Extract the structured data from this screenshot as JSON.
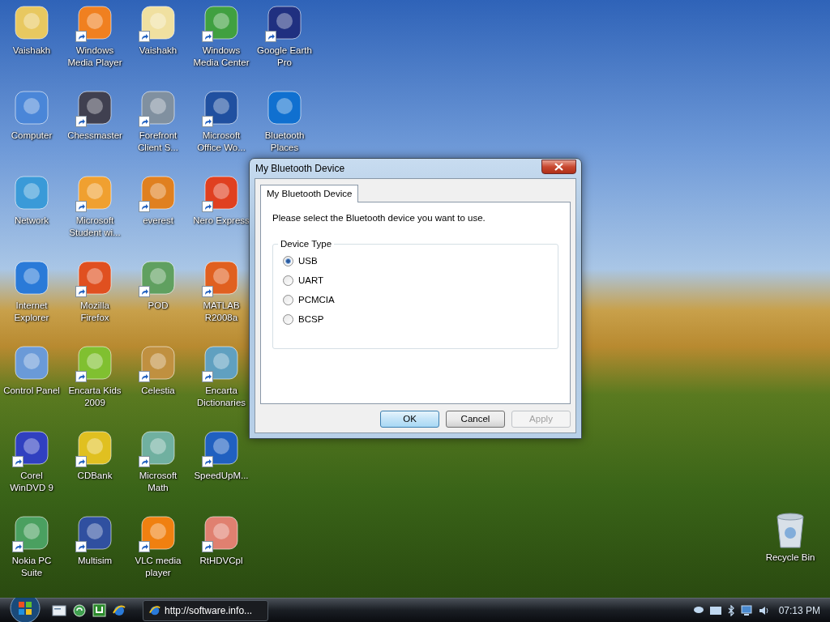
{
  "desktop": {
    "icons": [
      {
        "label": "Vaishakh",
        "shortcut": false
      },
      {
        "label": "Computer",
        "shortcut": false
      },
      {
        "label": "Network",
        "shortcut": false
      },
      {
        "label": "Internet Explorer",
        "shortcut": false
      },
      {
        "label": "Control Panel",
        "shortcut": false
      },
      {
        "label": "Corel WinDVD 9",
        "shortcut": true
      },
      {
        "label": "Nokia PC Suite",
        "shortcut": true
      },
      {
        "label": "Windows Media Player",
        "shortcut": true
      },
      {
        "label": "Chessmaster",
        "shortcut": true
      },
      {
        "label": "Microsoft Student wi...",
        "shortcut": true
      },
      {
        "label": "Mozilla Firefox",
        "shortcut": true
      },
      {
        "label": "Encarta Kids 2009",
        "shortcut": true
      },
      {
        "label": "CDBank",
        "shortcut": true
      },
      {
        "label": "Multisim",
        "shortcut": true
      },
      {
        "label": "Vaishakh",
        "shortcut": true
      },
      {
        "label": "Forefront Client S...",
        "shortcut": true
      },
      {
        "label": "everest",
        "shortcut": true
      },
      {
        "label": "POD",
        "shortcut": true
      },
      {
        "label": "Celestia",
        "shortcut": true
      },
      {
        "label": "Microsoft Math",
        "shortcut": true
      },
      {
        "label": "VLC media player",
        "shortcut": true
      },
      {
        "label": "Windows Media Center",
        "shortcut": true
      },
      {
        "label": "Microsoft Office Wo...",
        "shortcut": true
      },
      {
        "label": "Nero Express",
        "shortcut": true
      },
      {
        "label": "MATLAB R2008a",
        "shortcut": true
      },
      {
        "label": "Encarta Dictionaries",
        "shortcut": true
      },
      {
        "label": "SpeedUpM...",
        "shortcut": true
      },
      {
        "label": "RtHDVCpl",
        "shortcut": true
      },
      {
        "label": "Google Earth Pro",
        "shortcut": true
      },
      {
        "label": "Bluetooth Places",
        "shortcut": false
      }
    ],
    "recycle_bin": {
      "label": "Recycle Bin"
    }
  },
  "dialog": {
    "title": "My Bluetooth Device",
    "tabs": [
      {
        "label": "My Bluetooth Device",
        "selected": true
      }
    ],
    "prompt": "Please select the Bluetooth device you want to use.",
    "group": {
      "label": "Device Type",
      "options": [
        {
          "label": "USB",
          "selected": true
        },
        {
          "label": "UART",
          "selected": false
        },
        {
          "label": "PCMCIA",
          "selected": false
        },
        {
          "label": "BCSP",
          "selected": false
        }
      ]
    },
    "buttons": [
      {
        "label": "OK",
        "default": true,
        "disabled": false
      },
      {
        "label": "Cancel",
        "default": false,
        "disabled": false
      },
      {
        "label": "Apply",
        "default": false,
        "disabled": true
      }
    ]
  },
  "taskbar": {
    "tasks": [
      {
        "label": "http://software.info...",
        "selected": false
      }
    ],
    "clock": "07:13 PM"
  }
}
